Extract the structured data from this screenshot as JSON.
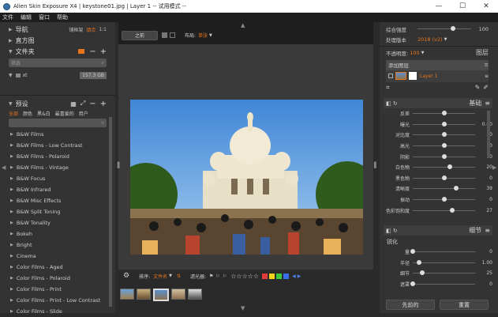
{
  "window": {
    "title": "Alien Skin Exposure X4 | keystone01.jpg | Layer 1 -- 试用模式 --",
    "minimize": "—",
    "maximize": "☐",
    "close": "✕"
  },
  "menu": [
    "文件",
    "编辑",
    "窗口",
    "帮助"
  ],
  "left": {
    "nav": {
      "label": "导航",
      "fit": "铺框架",
      "fill": "填合",
      "zoom": "1:1"
    },
    "histogram": {
      "label": "直方图"
    },
    "folders": {
      "label": "文件夹",
      "search_placeholder": "筛选",
      "drive": "xt",
      "size": "157.3 GB"
    },
    "presets": {
      "label": "预设",
      "tabs": [
        "全部",
        "颜色",
        "黑&白",
        "最喜爱的",
        "用户"
      ],
      "items": [
        "B&W Films",
        "B&W Films - Low Contrast",
        "B&W Films - Polaroid",
        "B&W Films - Vintage",
        "B&W Focus",
        "B&W Infrared",
        "B&W Misc Effects",
        "B&W Split Toning",
        "B&W Tonality",
        "Bokeh",
        "Bright",
        "Cinema",
        "Color Films - Aged",
        "Color Films - Polaroid",
        "Color Films - Print",
        "Color Films - Print - Low Contrast",
        "Color Films - Slide"
      ]
    }
  },
  "center": {
    "before_btn": "之前",
    "layout_label": "布局:",
    "layout_value": "单张",
    "sort_label": "排序:",
    "sort_value": "文件名",
    "filter_label": "滤光器:",
    "stars": "☆☆☆☆☆",
    "colors": [
      "#e23b3b",
      "#f2d21b",
      "#3cc73c",
      "#3a6ee8"
    ]
  },
  "right": {
    "overall_strength": {
      "label": "综合强度",
      "value": "100"
    },
    "process_version": {
      "label": "处理版本",
      "value": "2018 (v2)"
    },
    "opacity": {
      "label": "不透明度:",
      "value": "100"
    },
    "layers_title": "图层",
    "add_layer": "添加图层",
    "layer_name": "Layer 1",
    "basic_title": "基础",
    "basic": [
      {
        "label": "反差",
        "value": ""
      },
      {
        "label": "曝光",
        "value": "0.00"
      },
      {
        "label": "对比度",
        "value": "0"
      },
      {
        "label": "高光",
        "value": "0"
      },
      {
        "label": "阴影",
        "value": "0"
      },
      {
        "label": "白色物",
        "value": "20"
      },
      {
        "label": "黑色物",
        "value": "0"
      },
      {
        "label": "清晰度",
        "value": "39"
      },
      {
        "label": "振动",
        "value": "0"
      },
      {
        "label": "色彩饱和度",
        "value": "27"
      }
    ],
    "detail_title": "细节",
    "sharpen_title": "锐化",
    "detail": [
      {
        "label": "量",
        "value": "0"
      },
      {
        "label": "半径",
        "value": "1.00"
      },
      {
        "label": "细节",
        "value": "25"
      },
      {
        "label": "遮罩",
        "value": "0"
      }
    ],
    "prev_btn": "先前的",
    "reset_btn": "重置"
  }
}
